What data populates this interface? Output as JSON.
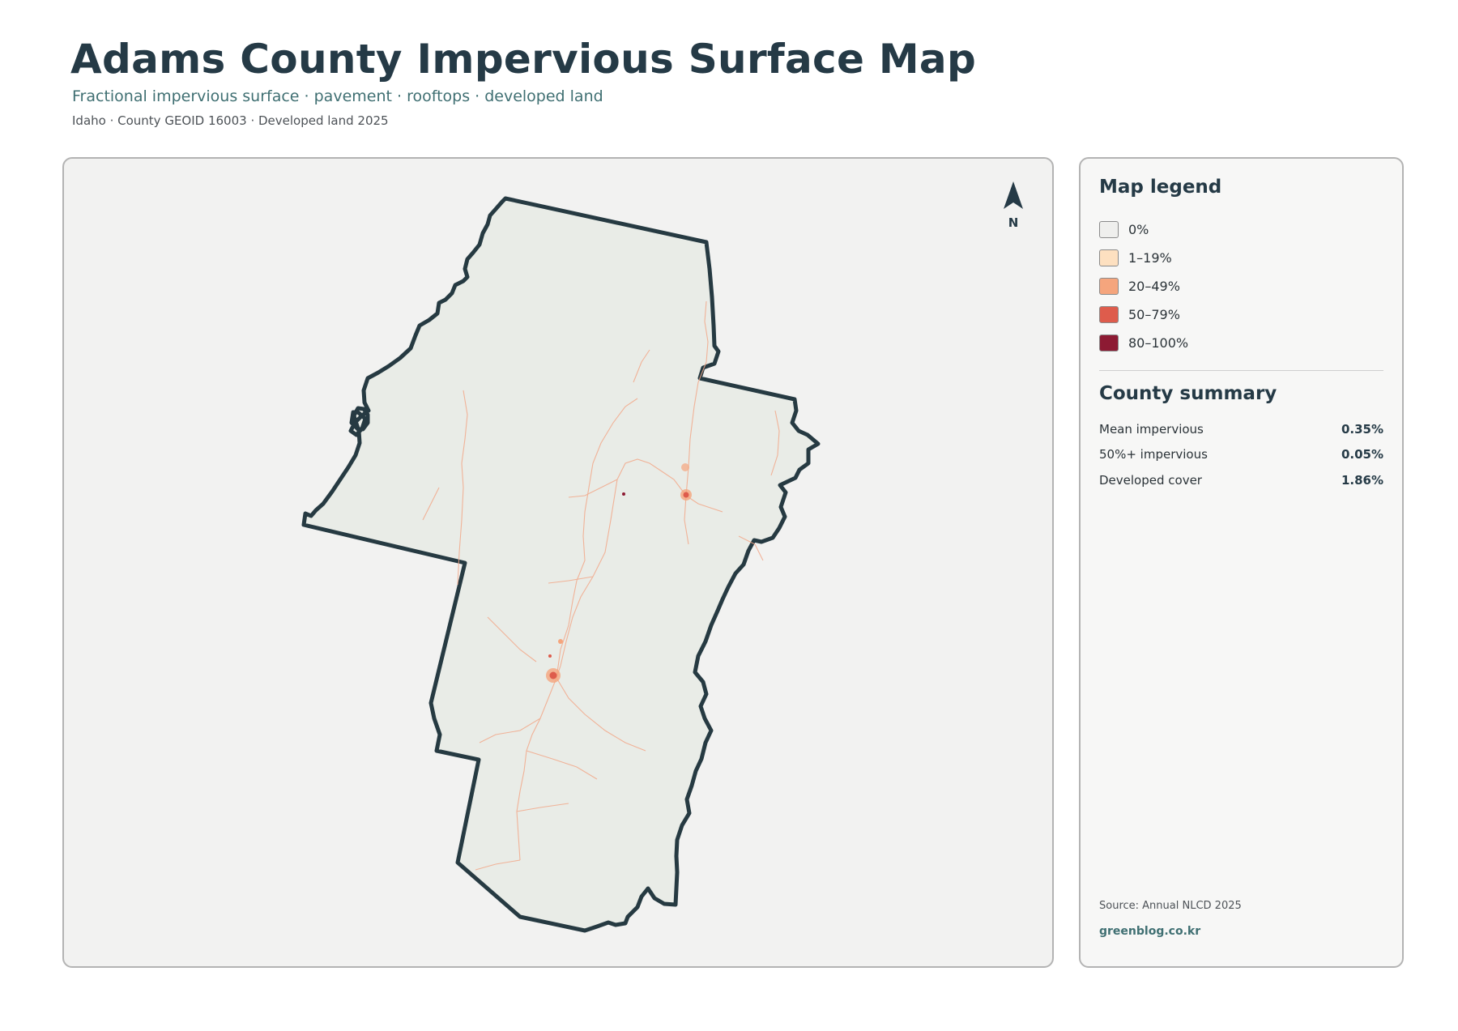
{
  "header": {
    "title": "Adams County Impervious Surface Map",
    "subtitle": "Fractional impervious surface · pavement · rooftops · developed land",
    "meta": "Idaho · County GEOID 16003 · Developed land 2025"
  },
  "map": {
    "north_label": "N",
    "county_fill": "#e9ece7",
    "county_outline": "#263a42"
  },
  "legend": {
    "title": "Map legend",
    "items": [
      {
        "label": "0%",
        "color": "#efefed"
      },
      {
        "label": "1–19%",
        "color": "#fde0c0"
      },
      {
        "label": "20–49%",
        "color": "#f5a57d"
      },
      {
        "label": "50–79%",
        "color": "#de5c4c"
      },
      {
        "label": "80–100%",
        "color": "#8d1a33"
      }
    ]
  },
  "summary": {
    "title": "County summary",
    "rows": [
      {
        "label": "Mean impervious",
        "value": "0.35%"
      },
      {
        "label": "50%+ impervious",
        "value": "0.05%"
      },
      {
        "label": "Developed cover",
        "value": "1.86%"
      }
    ]
  },
  "footer": {
    "source": "Source: Annual NLCD 2025",
    "brand": "greenblog.co.kr"
  }
}
